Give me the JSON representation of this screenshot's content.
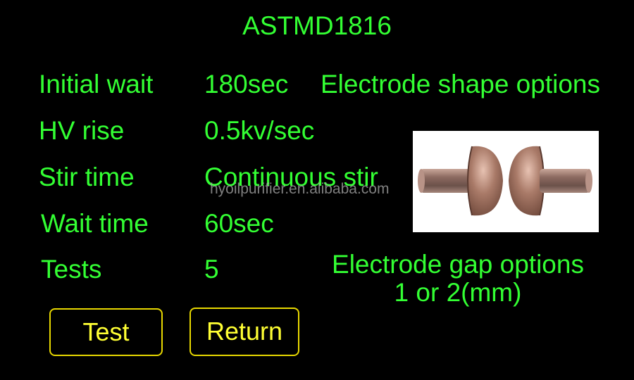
{
  "title": "ASTMD1816",
  "params": [
    {
      "label": "Initial wait",
      "value": "180sec"
    },
    {
      "label": "HV rise",
      "value": "0.5kv/sec"
    },
    {
      "label": "Stir time",
      "value": "Continuous stir"
    },
    {
      "label": "Wait time",
      "value": "60sec"
    },
    {
      "label": "Tests",
      "value": "5"
    }
  ],
  "electrode_shape": {
    "title": "Electrode shape options",
    "image_icon": "electrode-pair-photo"
  },
  "electrode_gap": {
    "title": "Electrode gap options",
    "value": "1 or 2(mm)"
  },
  "buttons": {
    "test": "Test",
    "return": "Return"
  },
  "watermark": "hyoilpurifier.en.alibaba.com",
  "colors": {
    "background": "#000000",
    "text": "#33ff33",
    "button_text": "#ffff33",
    "button_border": "#e8d800"
  }
}
